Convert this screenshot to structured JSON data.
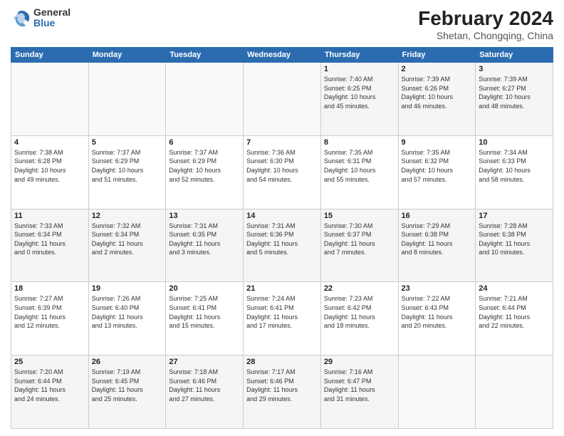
{
  "logo": {
    "general": "General",
    "blue": "Blue"
  },
  "title": {
    "month": "February 2024",
    "location": "Shetan, Chongqing, China"
  },
  "weekdays": [
    "Sunday",
    "Monday",
    "Tuesday",
    "Wednesday",
    "Thursday",
    "Friday",
    "Saturday"
  ],
  "rows": [
    [
      {
        "day": "",
        "info": ""
      },
      {
        "day": "",
        "info": ""
      },
      {
        "day": "",
        "info": ""
      },
      {
        "day": "",
        "info": ""
      },
      {
        "day": "1",
        "info": "Sunrise: 7:40 AM\nSunset: 6:25 PM\nDaylight: 10 hours\nand 45 minutes."
      },
      {
        "day": "2",
        "info": "Sunrise: 7:39 AM\nSunset: 6:26 PM\nDaylight: 10 hours\nand 46 minutes."
      },
      {
        "day": "3",
        "info": "Sunrise: 7:39 AM\nSunset: 6:27 PM\nDaylight: 10 hours\nand 48 minutes."
      }
    ],
    [
      {
        "day": "4",
        "info": "Sunrise: 7:38 AM\nSunset: 6:28 PM\nDaylight: 10 hours\nand 49 minutes."
      },
      {
        "day": "5",
        "info": "Sunrise: 7:37 AM\nSunset: 6:29 PM\nDaylight: 10 hours\nand 51 minutes."
      },
      {
        "day": "6",
        "info": "Sunrise: 7:37 AM\nSunset: 6:29 PM\nDaylight: 10 hours\nand 52 minutes."
      },
      {
        "day": "7",
        "info": "Sunrise: 7:36 AM\nSunset: 6:30 PM\nDaylight: 10 hours\nand 54 minutes."
      },
      {
        "day": "8",
        "info": "Sunrise: 7:35 AM\nSunset: 6:31 PM\nDaylight: 10 hours\nand 55 minutes."
      },
      {
        "day": "9",
        "info": "Sunrise: 7:35 AM\nSunset: 6:32 PM\nDaylight: 10 hours\nand 57 minutes."
      },
      {
        "day": "10",
        "info": "Sunrise: 7:34 AM\nSunset: 6:33 PM\nDaylight: 10 hours\nand 58 minutes."
      }
    ],
    [
      {
        "day": "11",
        "info": "Sunrise: 7:33 AM\nSunset: 6:34 PM\nDaylight: 11 hours\nand 0 minutes."
      },
      {
        "day": "12",
        "info": "Sunrise: 7:32 AM\nSunset: 6:34 PM\nDaylight: 11 hours\nand 2 minutes."
      },
      {
        "day": "13",
        "info": "Sunrise: 7:31 AM\nSunset: 6:35 PM\nDaylight: 11 hours\nand 3 minutes."
      },
      {
        "day": "14",
        "info": "Sunrise: 7:31 AM\nSunset: 6:36 PM\nDaylight: 11 hours\nand 5 minutes."
      },
      {
        "day": "15",
        "info": "Sunrise: 7:30 AM\nSunset: 6:37 PM\nDaylight: 11 hours\nand 7 minutes."
      },
      {
        "day": "16",
        "info": "Sunrise: 7:29 AM\nSunset: 6:38 PM\nDaylight: 11 hours\nand 8 minutes."
      },
      {
        "day": "17",
        "info": "Sunrise: 7:28 AM\nSunset: 6:38 PM\nDaylight: 11 hours\nand 10 minutes."
      }
    ],
    [
      {
        "day": "18",
        "info": "Sunrise: 7:27 AM\nSunset: 6:39 PM\nDaylight: 11 hours\nand 12 minutes."
      },
      {
        "day": "19",
        "info": "Sunrise: 7:26 AM\nSunset: 6:40 PM\nDaylight: 11 hours\nand 13 minutes."
      },
      {
        "day": "20",
        "info": "Sunrise: 7:25 AM\nSunset: 6:41 PM\nDaylight: 11 hours\nand 15 minutes."
      },
      {
        "day": "21",
        "info": "Sunrise: 7:24 AM\nSunset: 6:41 PM\nDaylight: 11 hours\nand 17 minutes."
      },
      {
        "day": "22",
        "info": "Sunrise: 7:23 AM\nSunset: 6:42 PM\nDaylight: 11 hours\nand 18 minutes."
      },
      {
        "day": "23",
        "info": "Sunrise: 7:22 AM\nSunset: 6:43 PM\nDaylight: 11 hours\nand 20 minutes."
      },
      {
        "day": "24",
        "info": "Sunrise: 7:21 AM\nSunset: 6:44 PM\nDaylight: 11 hours\nand 22 minutes."
      }
    ],
    [
      {
        "day": "25",
        "info": "Sunrise: 7:20 AM\nSunset: 6:44 PM\nDaylight: 11 hours\nand 24 minutes."
      },
      {
        "day": "26",
        "info": "Sunrise: 7:19 AM\nSunset: 6:45 PM\nDaylight: 11 hours\nand 25 minutes."
      },
      {
        "day": "27",
        "info": "Sunrise: 7:18 AM\nSunset: 6:46 PM\nDaylight: 11 hours\nand 27 minutes."
      },
      {
        "day": "28",
        "info": "Sunrise: 7:17 AM\nSunset: 6:46 PM\nDaylight: 11 hours\nand 29 minutes."
      },
      {
        "day": "29",
        "info": "Sunrise: 7:16 AM\nSunset: 6:47 PM\nDaylight: 11 hours\nand 31 minutes."
      },
      {
        "day": "",
        "info": ""
      },
      {
        "day": "",
        "info": ""
      }
    ]
  ]
}
